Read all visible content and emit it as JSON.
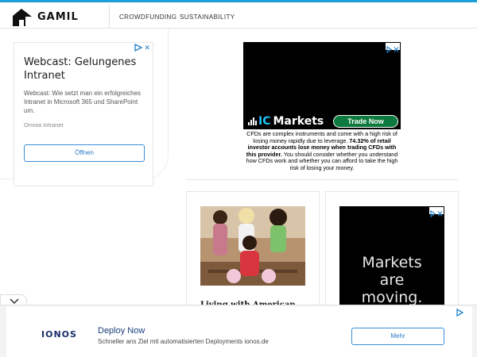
{
  "header": {
    "brand": "GAMIL",
    "nav": [
      {
        "label": "CROWDFUNDING"
      },
      {
        "label": "SUSTAINABILITY"
      }
    ]
  },
  "left_ad": {
    "title": "Webcast: Gelungenes Intranet",
    "description": "Webcast: Wie setzt man ein erfolgreiches Intranet in Microsoft 365 und SharePoint um.",
    "advertiser": "Omnia Intranet",
    "button": "Öffnen"
  },
  "ic_markets_ad": {
    "logo_ic": "IC",
    "logo_markets": "Markets",
    "button": "Trade Now",
    "risk_part1": "CFDs are complex instruments and come with a high risk of losing money rapidly due to leverage. ",
    "risk_bold": "74.32% of retail investor accounts lose money when trading CFDs with this provider.",
    "risk_part2": " You should consider whether you understand how CFDs work and whether you can afford to take the high risk of losing your money."
  },
  "article": {
    "title": "Living with American"
  },
  "markets_ad": {
    "line1": "Markets",
    "line2": "are moving."
  },
  "bottom_ad": {
    "brand": "IONOS",
    "headline": "Deploy Now",
    "subline": "Schneller ans Ziel mit automatisierten Deployments ionos.de",
    "button": "Mehr"
  },
  "colors": {
    "accent": "#1f9fd8",
    "ad_link": "#2a7cc7",
    "trade_green": "#0c7a3e",
    "ic_cyan": "#20c2f5"
  },
  "icons": [
    "logo-icon",
    "ad-choices-icon",
    "close-icon",
    "chevron-down-icon"
  ]
}
